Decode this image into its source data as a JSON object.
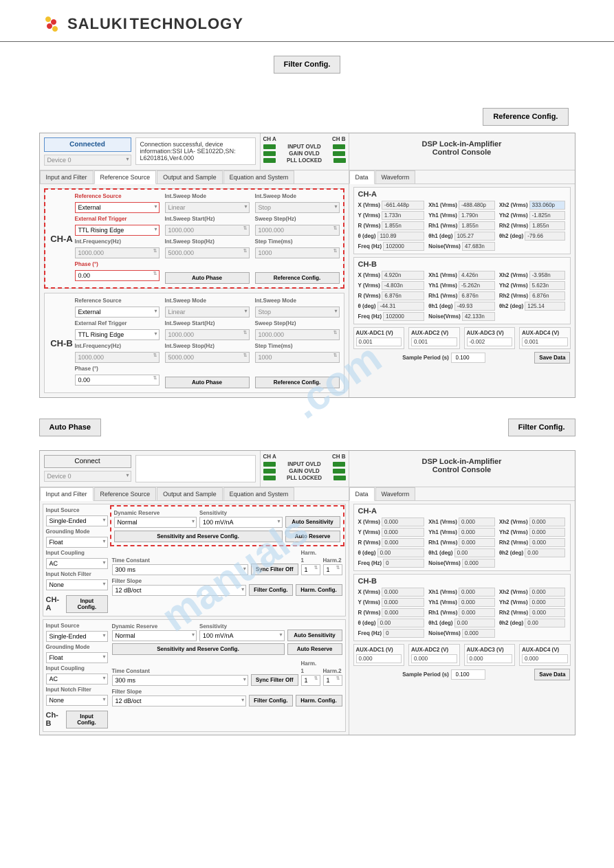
{
  "brand": {
    "name": "SALUKI",
    "sub": "TECHNOLOGY"
  },
  "topButtons": {
    "filterConfig": "Filter Config.",
    "referenceConfig": "Reference Config.",
    "autoPhase": "Auto Phase"
  },
  "appTitle": "DSP Lock-in-Amplifier\nControl Console",
  "app1": {
    "connect": "Connected",
    "device": "Device 0",
    "info": "Connection successful, device information:SSI LIA- SE1022D,SN: L6201816,Ver4.000",
    "status": {
      "cha": "CH A",
      "chb": "CH B",
      "r1": "INPUT OVLD",
      "r2": "GAIN OVLD",
      "r3": "PLL LOCKED"
    },
    "tabs": [
      "Input and Filter",
      "Reference Source",
      "Output and Sample",
      "Equation and System"
    ],
    "activeTab": 1,
    "cha": {
      "refSrc": {
        "lbl": "Reference Source",
        "v": "External"
      },
      "extTrig": {
        "lbl": "External Ref Trigger",
        "v": "TTL Rising Edge"
      },
      "intFreq": {
        "lbl": "Int.Frequency(Hz)",
        "v": "1000.000"
      },
      "phase": {
        "lbl": "Phase (°)",
        "v": "0.00"
      },
      "swMode": {
        "lbl": "Int.Sweep Mode",
        "v": "Linear"
      },
      "swStart": {
        "lbl": "Int.Sweep Start(Hz)",
        "v": "1000.000"
      },
      "swStop": {
        "lbl": "Int.Sweep Stop(Hz)",
        "v": "5000.000"
      },
      "swMode2": {
        "lbl": "Int.Sweep Mode",
        "v": "Stop"
      },
      "swStep": {
        "lbl": "Sweep Step(Hz)",
        "v": "1000.000"
      },
      "stepTime": {
        "lbl": "Step Time(ms)",
        "v": "1000"
      },
      "autoPhase": "Auto Phase",
      "refConf": "Reference Config."
    },
    "chb": {
      "refSrc": {
        "lbl": "Reference Source",
        "v": "External"
      },
      "extTrig": {
        "lbl": "External Ref Trigger",
        "v": "TTL Rising Edge"
      },
      "intFreq": {
        "lbl": "Int.Frequency(Hz)",
        "v": "1000.000"
      },
      "phase": {
        "lbl": "Phase (°)",
        "v": "0.00"
      },
      "swMode": {
        "lbl": "Int.Sweep Mode",
        "v": "Linear"
      },
      "swStart": {
        "lbl": "Int.Sweep Start(Hz)",
        "v": "1000.000"
      },
      "swStop": {
        "lbl": "Int.Sweep Stop(Hz)",
        "v": "5000.000"
      },
      "swMode2": {
        "lbl": "Int.Sweep Mode",
        "v": "Stop"
      },
      "swStep": {
        "lbl": "Sweep Step(Hz)",
        "v": "1000.000"
      },
      "stepTime": {
        "lbl": "Step Time(ms)",
        "v": "1000"
      },
      "autoPhase": "Auto Phase",
      "refConf": "Reference Config."
    },
    "dataTabs": [
      "Data",
      "Waveform"
    ],
    "dcha": {
      "title": "CH-A",
      "x": "-661.448p",
      "xh1": "-488.480p",
      "xh2": "333.060p",
      "y": "1.733n",
      "yh1": "1.790n",
      "yh2": "-1.825n",
      "r": "1.855n",
      "rh1": "1.855n",
      "rh2": "1.855n",
      "th": "110.89",
      "th1": "105.27",
      "th2": "-79.66",
      "freq": "102000",
      "noise": "47.683n"
    },
    "dchb": {
      "title": "CH-B",
      "x": "4.920n",
      "xh1": "4.426n",
      "xh2": "-3.958n",
      "y": "-4.803n",
      "yh1": "-5.262n",
      "yh2": "5.623n",
      "r": "6.876n",
      "rh1": "6.876n",
      "rh2": "6.876n",
      "th": "-44.31",
      "th1": "-49.93",
      "th2": "125.14",
      "freq": "102000",
      "noise": "42.133n"
    },
    "aux": {
      "a1": "0.001",
      "a2": "0.001",
      "a3": "-0.002",
      "a4": "0.001"
    },
    "auxLbl": {
      "a1": "AUX-ADC1 (V)",
      "a2": "AUX-ADC2 (V)",
      "a3": "AUX-ADC3 (V)",
      "a4": "AUX-ADC4 (V)"
    },
    "samplePeriod": {
      "lbl": "Sample Period (s)",
      "v": "0.100"
    },
    "saveData": "Save Data"
  },
  "app2": {
    "connect": "Connect",
    "device": "Device 0",
    "status": {
      "cha": "CH A",
      "chb": "CH B",
      "r1": "INPUT OVLD",
      "r2": "GAIN OVLD",
      "r3": "PLL LOCKED"
    },
    "tabs": [
      "Input and Filter",
      "Reference Source",
      "Output and Sample",
      "Equation and System"
    ],
    "activeTab": 0,
    "chA": {
      "inputSource": {
        "lbl": "Input Source",
        "v": "Single-Ended"
      },
      "grounding": {
        "lbl": "Grounding Mode",
        "v": "Float"
      },
      "coupling": {
        "lbl": "Input Coupling",
        "v": "AC"
      },
      "notch": {
        "lbl": "Input Notch Filter",
        "v": "None"
      },
      "chLbl": "CH-A",
      "inputConfig": "Input Config.",
      "dynRes": {
        "lbl": "Dynamic Reserve",
        "v": "Normal"
      },
      "sens": {
        "lbl": "Sensitivity",
        "v": "100 mV/nA"
      },
      "autoSens": "Auto Sensitivity",
      "srConf": "Sensitivity and Reserve Config.",
      "autoRes": "Auto Reserve",
      "timeConst": {
        "lbl": "Time Constant",
        "v": "300 ms"
      },
      "syncFilter": "Sync Filter Off",
      "filterSlope": {
        "lbl": "Filter Slope",
        "v": "12 dB/oct"
      },
      "filterConfig": "Filter Config.",
      "harm1": {
        "lbl": "Harm. 1",
        "v": "1"
      },
      "harm2": {
        "lbl": "Harm.2",
        "v": "1"
      },
      "harmConfig": "Harm.  Config."
    },
    "chB": {
      "inputSource": {
        "lbl": "Input Source",
        "v": "Single-Ended"
      },
      "grounding": {
        "lbl": "Grounding Mode",
        "v": "Float"
      },
      "coupling": {
        "lbl": "Input Coupling",
        "v": "AC"
      },
      "notch": {
        "lbl": "Input Notch Filter",
        "v": "None"
      },
      "chLbl": "Ch-B",
      "inputConfig": "Input Config.",
      "dynRes": {
        "lbl": "Dynamic Reserve",
        "v": "Normal"
      },
      "sens": {
        "lbl": "Sensitivity",
        "v": "100 mV/nA"
      },
      "autoSens": "Auto Sensitivity",
      "srConf": "Sensitivity and Reserve Config.",
      "autoRes": "Auto Reserve",
      "timeConst": {
        "lbl": "Time Constant",
        "v": "300 ms"
      },
      "syncFilter": "Sync Filter Off",
      "filterSlope": {
        "lbl": "Filter Slope",
        "v": "12 dB/oct"
      },
      "filterConfig": "Filter Config.",
      "harm1": {
        "lbl": "Harm. 1",
        "v": "1"
      },
      "harm2": {
        "lbl": "Harm.2",
        "v": "1"
      },
      "harmConfig": "Harm.  Config."
    },
    "dataTabs": [
      "Data",
      "Waveform"
    ],
    "dcha": {
      "title": "CH-A",
      "x": "0.000",
      "xh1": "0.000",
      "xh2": "0.000",
      "y": "0.000",
      "yh1": "0.000",
      "yh2": "0.000",
      "r": "0.000",
      "rh1": "0.000",
      "rh2": "0.000",
      "th": "0.00",
      "th1": "0.00",
      "th2": "0.00",
      "freq": "0",
      "noise": "0.000"
    },
    "dchb": {
      "title": "CH-B",
      "x": "0.000",
      "xh1": "0.000",
      "xh2": "0.000",
      "y": "0.000",
      "yh1": "0.000",
      "yh2": "0.000",
      "r": "0.000",
      "rh1": "0.000",
      "rh2": "0.000",
      "th": "0.00",
      "th1": "0.00",
      "th2": "0.00",
      "freq": "0",
      "noise": "0.000"
    },
    "aux": {
      "a1": "0.000",
      "a2": "0.000",
      "a3": "0.000",
      "a4": "0.000"
    },
    "samplePeriod": {
      "lbl": "Sample Period (s)",
      "v": "0.100"
    },
    "saveData": "Save Data"
  },
  "labels": {
    "x": "X (Vrms)",
    "xh1": "Xh1 (Vrms)",
    "xh2": "Xh2 (Vrms)",
    "y": "Y (Vrms)",
    "yh1": "Yh1 (Vrms)",
    "yh2": "Yh2 (Vrms)",
    "r": "R (Vrms)",
    "rh1": "Rh1 (Vrms)",
    "rh2": "Rh2 (Vrms)",
    "th": "θ  (deg)",
    "th1": "θh1  (deg)",
    "th2": "θh2  (deg)",
    "freq": "Freq (Hz)",
    "noise": "Noise(Vrms)",
    "chaLabel": "CH-A",
    "chbLabel": "CH-B"
  }
}
